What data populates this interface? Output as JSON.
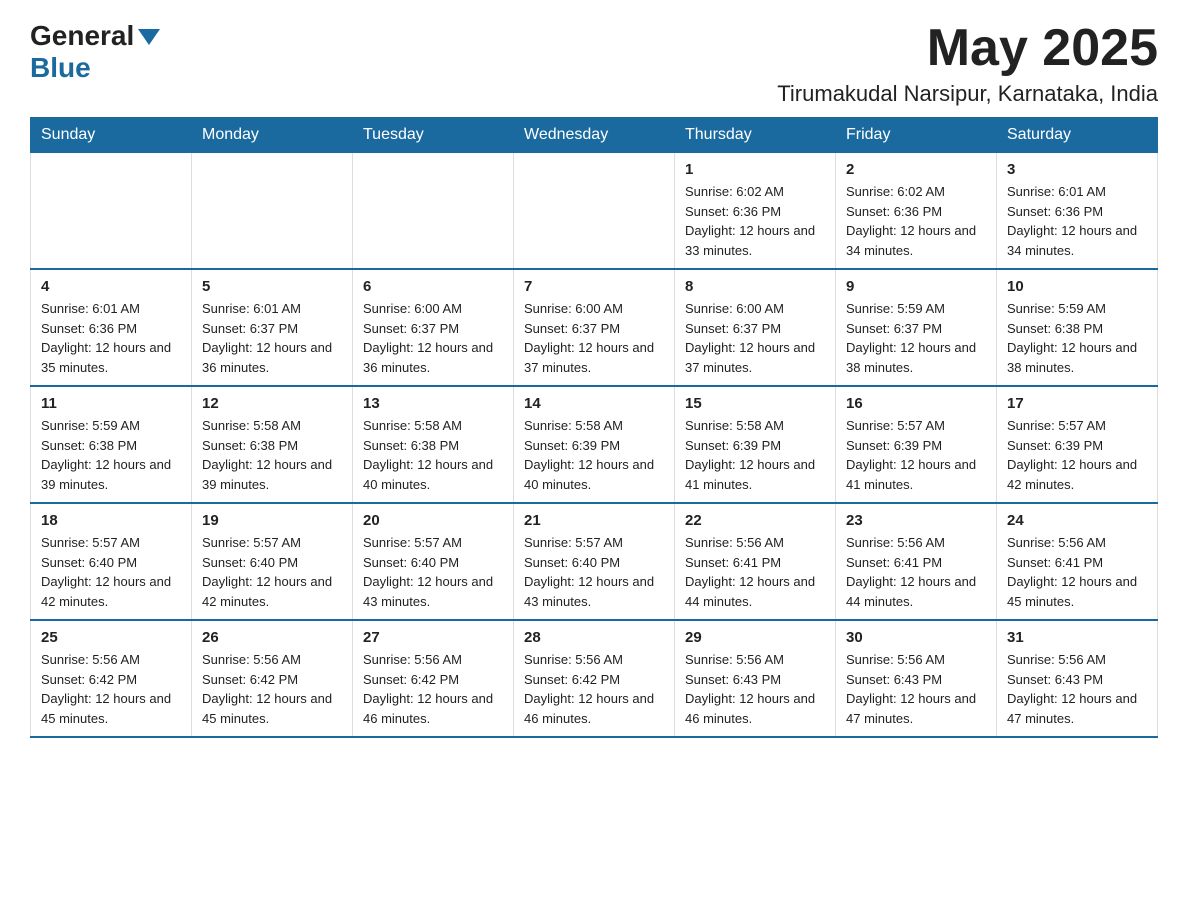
{
  "header": {
    "logo": {
      "general": "General",
      "blue": "Blue",
      "arrow": "▼"
    },
    "title": "May 2025",
    "location": "Tirumakudal Narsipur, Karnataka, India"
  },
  "calendar": {
    "days_of_week": [
      "Sunday",
      "Monday",
      "Tuesday",
      "Wednesday",
      "Thursday",
      "Friday",
      "Saturday"
    ],
    "weeks": [
      [
        {
          "day": "",
          "info": ""
        },
        {
          "day": "",
          "info": ""
        },
        {
          "day": "",
          "info": ""
        },
        {
          "day": "",
          "info": ""
        },
        {
          "day": "1",
          "info": "Sunrise: 6:02 AM\nSunset: 6:36 PM\nDaylight: 12 hours and 33 minutes."
        },
        {
          "day": "2",
          "info": "Sunrise: 6:02 AM\nSunset: 6:36 PM\nDaylight: 12 hours and 34 minutes."
        },
        {
          "day": "3",
          "info": "Sunrise: 6:01 AM\nSunset: 6:36 PM\nDaylight: 12 hours and 34 minutes."
        }
      ],
      [
        {
          "day": "4",
          "info": "Sunrise: 6:01 AM\nSunset: 6:36 PM\nDaylight: 12 hours and 35 minutes."
        },
        {
          "day": "5",
          "info": "Sunrise: 6:01 AM\nSunset: 6:37 PM\nDaylight: 12 hours and 36 minutes."
        },
        {
          "day": "6",
          "info": "Sunrise: 6:00 AM\nSunset: 6:37 PM\nDaylight: 12 hours and 36 minutes."
        },
        {
          "day": "7",
          "info": "Sunrise: 6:00 AM\nSunset: 6:37 PM\nDaylight: 12 hours and 37 minutes."
        },
        {
          "day": "8",
          "info": "Sunrise: 6:00 AM\nSunset: 6:37 PM\nDaylight: 12 hours and 37 minutes."
        },
        {
          "day": "9",
          "info": "Sunrise: 5:59 AM\nSunset: 6:37 PM\nDaylight: 12 hours and 38 minutes."
        },
        {
          "day": "10",
          "info": "Sunrise: 5:59 AM\nSunset: 6:38 PM\nDaylight: 12 hours and 38 minutes."
        }
      ],
      [
        {
          "day": "11",
          "info": "Sunrise: 5:59 AM\nSunset: 6:38 PM\nDaylight: 12 hours and 39 minutes."
        },
        {
          "day": "12",
          "info": "Sunrise: 5:58 AM\nSunset: 6:38 PM\nDaylight: 12 hours and 39 minutes."
        },
        {
          "day": "13",
          "info": "Sunrise: 5:58 AM\nSunset: 6:38 PM\nDaylight: 12 hours and 40 minutes."
        },
        {
          "day": "14",
          "info": "Sunrise: 5:58 AM\nSunset: 6:39 PM\nDaylight: 12 hours and 40 minutes."
        },
        {
          "day": "15",
          "info": "Sunrise: 5:58 AM\nSunset: 6:39 PM\nDaylight: 12 hours and 41 minutes."
        },
        {
          "day": "16",
          "info": "Sunrise: 5:57 AM\nSunset: 6:39 PM\nDaylight: 12 hours and 41 minutes."
        },
        {
          "day": "17",
          "info": "Sunrise: 5:57 AM\nSunset: 6:39 PM\nDaylight: 12 hours and 42 minutes."
        }
      ],
      [
        {
          "day": "18",
          "info": "Sunrise: 5:57 AM\nSunset: 6:40 PM\nDaylight: 12 hours and 42 minutes."
        },
        {
          "day": "19",
          "info": "Sunrise: 5:57 AM\nSunset: 6:40 PM\nDaylight: 12 hours and 42 minutes."
        },
        {
          "day": "20",
          "info": "Sunrise: 5:57 AM\nSunset: 6:40 PM\nDaylight: 12 hours and 43 minutes."
        },
        {
          "day": "21",
          "info": "Sunrise: 5:57 AM\nSunset: 6:40 PM\nDaylight: 12 hours and 43 minutes."
        },
        {
          "day": "22",
          "info": "Sunrise: 5:56 AM\nSunset: 6:41 PM\nDaylight: 12 hours and 44 minutes."
        },
        {
          "day": "23",
          "info": "Sunrise: 5:56 AM\nSunset: 6:41 PM\nDaylight: 12 hours and 44 minutes."
        },
        {
          "day": "24",
          "info": "Sunrise: 5:56 AM\nSunset: 6:41 PM\nDaylight: 12 hours and 45 minutes."
        }
      ],
      [
        {
          "day": "25",
          "info": "Sunrise: 5:56 AM\nSunset: 6:42 PM\nDaylight: 12 hours and 45 minutes."
        },
        {
          "day": "26",
          "info": "Sunrise: 5:56 AM\nSunset: 6:42 PM\nDaylight: 12 hours and 45 minutes."
        },
        {
          "day": "27",
          "info": "Sunrise: 5:56 AM\nSunset: 6:42 PM\nDaylight: 12 hours and 46 minutes."
        },
        {
          "day": "28",
          "info": "Sunrise: 5:56 AM\nSunset: 6:42 PM\nDaylight: 12 hours and 46 minutes."
        },
        {
          "day": "29",
          "info": "Sunrise: 5:56 AM\nSunset: 6:43 PM\nDaylight: 12 hours and 46 minutes."
        },
        {
          "day": "30",
          "info": "Sunrise: 5:56 AM\nSunset: 6:43 PM\nDaylight: 12 hours and 47 minutes."
        },
        {
          "day": "31",
          "info": "Sunrise: 5:56 AM\nSunset: 6:43 PM\nDaylight: 12 hours and 47 minutes."
        }
      ]
    ]
  }
}
